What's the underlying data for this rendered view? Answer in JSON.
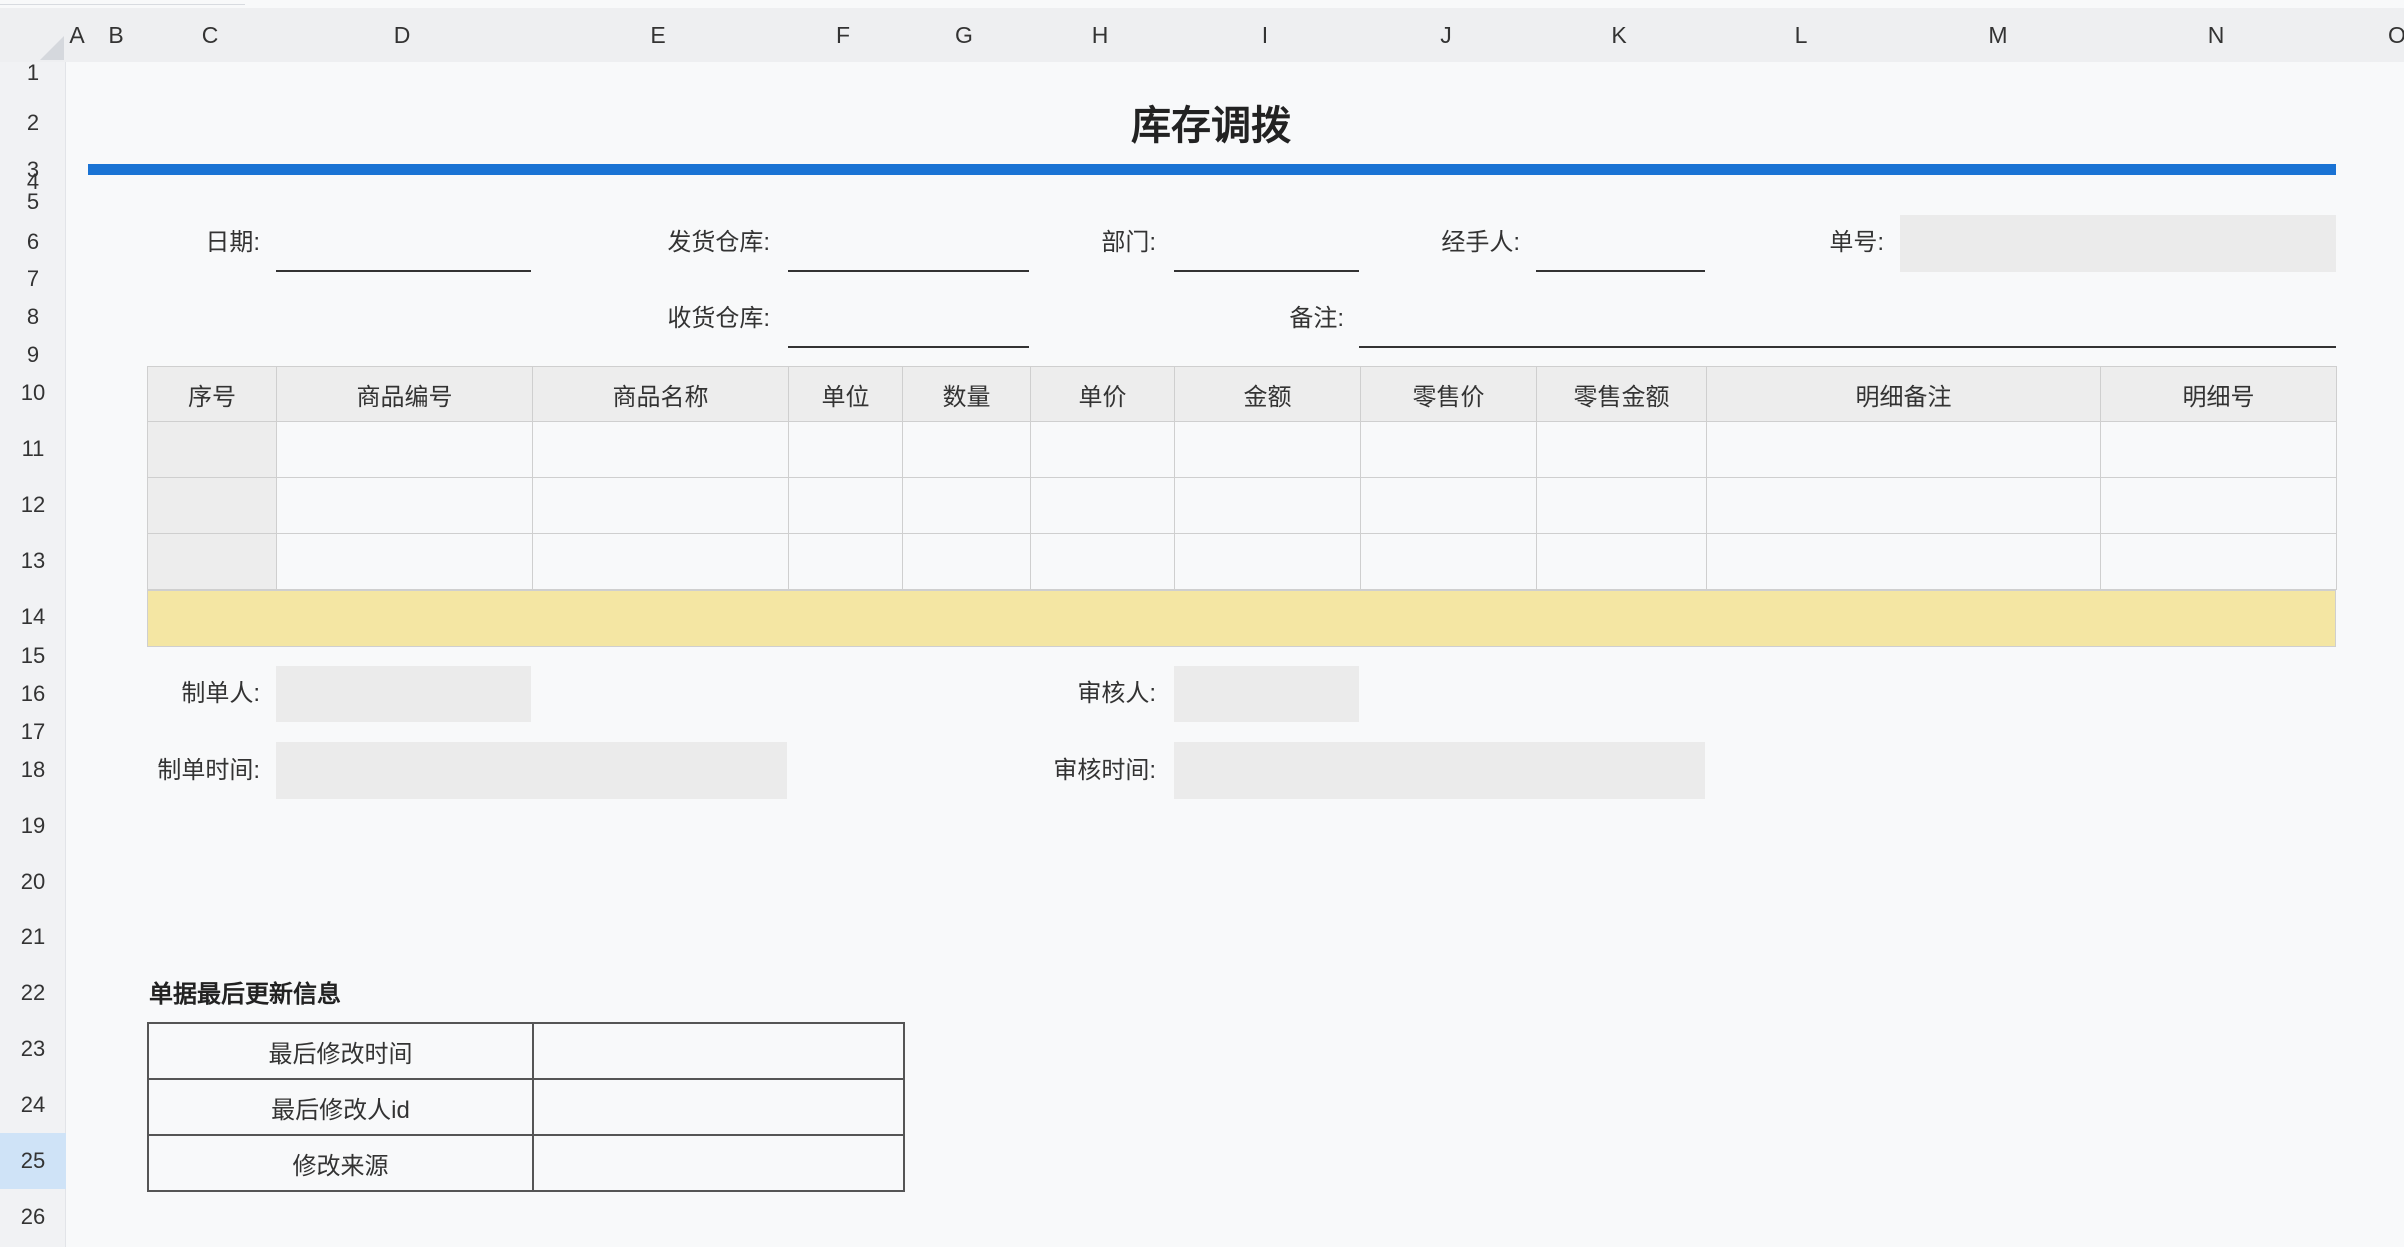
{
  "sheet": {
    "columns": [
      "A",
      "B",
      "C",
      "D",
      "E",
      "F",
      "G",
      "H",
      "I",
      "J",
      "K",
      "L",
      "M",
      "N",
      "O"
    ],
    "rows": [
      "1",
      "2",
      "3",
      "4",
      "5",
      "6",
      "7",
      "8",
      "9",
      "10",
      "11",
      "12",
      "13",
      "14",
      "15",
      "16",
      "17",
      "18",
      "19",
      "20",
      "21",
      "22",
      "23",
      "24",
      "25",
      "26"
    ],
    "selected_row": "25"
  },
  "form": {
    "title": "库存调拨",
    "date_label": "日期:",
    "ship_warehouse_label": "发货仓库:",
    "department_label": "部门:",
    "handler_label": "经手人:",
    "order_no_label": "单号:",
    "receive_warehouse_label": "收货仓库:",
    "remark_label": "备注:"
  },
  "table": {
    "headers": [
      "序号",
      "商品编号",
      "商品名称",
      "单位",
      "数量",
      "单价",
      "金额",
      "零售价",
      "零售金额",
      "明细备注",
      "明细号"
    ],
    "row_count": 3
  },
  "footer": {
    "creator_label": "制单人:",
    "reviewer_label": "审核人:",
    "create_time_label": "制单时间:",
    "review_time_label": "审核时间:"
  },
  "update_info": {
    "title": "单据最后更新信息",
    "rows": [
      {
        "label": "最后修改时间",
        "value": ""
      },
      {
        "label": "最后修改人id",
        "value": ""
      },
      {
        "label": "修改来源",
        "value": ""
      }
    ]
  },
  "colors": {
    "accent_bar": "#1a73d4",
    "total_row": "#f4e6a3",
    "field_gray": "#ebebeb",
    "selected_row": "#cfe3f7"
  }
}
